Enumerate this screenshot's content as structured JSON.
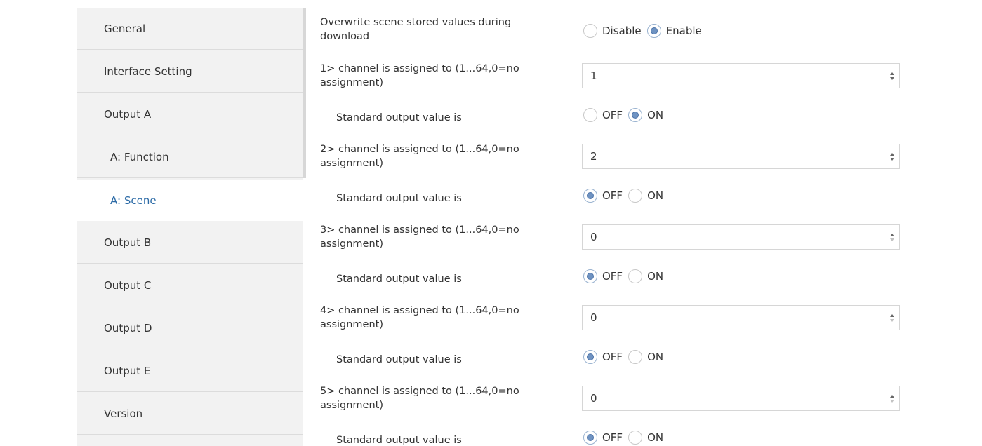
{
  "sidebar": {
    "items": [
      {
        "label": "General"
      },
      {
        "label": "Interface Setting"
      },
      {
        "label": "Output A"
      },
      {
        "label": "A: Function"
      },
      {
        "label": "A: Scene"
      },
      {
        "label": "Output B"
      },
      {
        "label": "Output C"
      },
      {
        "label": "Output D"
      },
      {
        "label": "Output E"
      },
      {
        "label": "Version"
      }
    ],
    "active": "A: Scene"
  },
  "content": {
    "overwrite": {
      "label_line1": "Overwrite scene stored values during",
      "label_line2": "download",
      "option_disable": "Disable",
      "option_enable": "Enable",
      "selected": "Enable"
    },
    "channels": [
      {
        "label_line1": "1> channel is assigned to (1...64,0=no",
        "label_line2": "assignment)",
        "value": "1",
        "output_label": "Standard output value is",
        "off": "OFF",
        "on": "ON",
        "selected": "ON"
      },
      {
        "label_line1": "2> channel is assigned to (1...64,0=no",
        "label_line2": "assignment)",
        "value": "2",
        "output_label": "Standard output value is",
        "off": "OFF",
        "on": "ON",
        "selected": "OFF"
      },
      {
        "label_line1": "3> channel is assigned to (1...64,0=no",
        "label_line2": "assignment)",
        "value": "0",
        "output_label": "Standard output value is",
        "off": "OFF",
        "on": "ON",
        "selected": "OFF"
      },
      {
        "label_line1": "4> channel is assigned to (1...64,0=no",
        "label_line2": "assignment)",
        "value": "0",
        "output_label": "Standard output value is",
        "off": "OFF",
        "on": "ON",
        "selected": "OFF"
      },
      {
        "label_line1": "5> channel is assigned to (1...64,0=no",
        "label_line2": "assignment)",
        "value": "0",
        "output_label": "Standard output value is",
        "off": "OFF",
        "on": "ON",
        "selected": "OFF"
      }
    ]
  },
  "colors": {
    "active_nav_text": "#2b6aa6",
    "sidebar_bg": "#f2f2f2",
    "radio_dot": "#6f93c2"
  },
  "icons": {
    "radio_on": "radio-checked-icon",
    "radio_off": "radio-unchecked-icon",
    "spin_up": "chevron-up-icon",
    "spin_down": "chevron-down-icon"
  }
}
